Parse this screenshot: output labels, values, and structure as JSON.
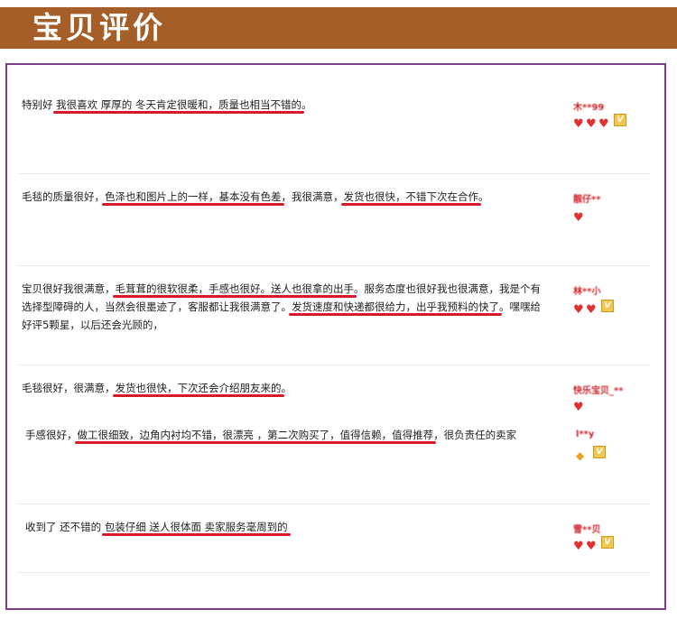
{
  "header": {
    "title": "宝贝评价",
    "bg_color": "#a65e28"
  },
  "panel": {
    "border_color": "#7b3f86"
  },
  "reviews": [
    {
      "segments": [
        {
          "text": "特别好  ",
          "hl": false
        },
        {
          "text": "我很喜欢  厚厚的  冬天肯定很暖和，质量也相当不错的",
          "hl": true
        },
        {
          "text": "。",
          "hl": false
        }
      ],
      "user": "木**99",
      "hearts": 3,
      "diamond": false,
      "vip": true
    },
    {
      "segments": [
        {
          "text": "毛毯的质量很好，",
          "hl": false
        },
        {
          "text": "色泽也和图片上的一样，基本没有色差",
          "hl": true
        },
        {
          "text": "，我很满意，",
          "hl": false
        },
        {
          "text": "发货也很快，不错下次在合作",
          "hl": true
        },
        {
          "text": "。",
          "hl": false
        }
      ],
      "user": "靓仔**",
      "hearts": 1,
      "diamond": false,
      "vip": false
    },
    {
      "segments": [
        {
          "text": "宝贝很好我很满意，",
          "hl": false
        },
        {
          "text": "毛茸茸的很软很柔，手感也很好。送人也很拿的出手",
          "hl": true
        },
        {
          "text": "。服务态度也很好我也很满意，我是个有选择型障碍的人，当然会很墨迹了，客服都让我很满意了。",
          "hl": false
        },
        {
          "text": "发货速度和快递都很给力，出乎我预料的快了",
          "hl": true
        },
        {
          "text": "。嘿嘿给好评5颗星，以后还会光顾的，",
          "hl": false
        }
      ],
      "user": "林**小",
      "hearts": 2,
      "diamond": false,
      "vip": true
    },
    {
      "segments": [
        {
          "text": "毛毯很好，很满意，",
          "hl": false
        },
        {
          "text": "发货也很快，下次还会介绍朋友来的",
          "hl": true
        },
        {
          "text": "。",
          "hl": false
        }
      ],
      "user": "快乐宝贝_**",
      "hearts": 1,
      "diamond": false,
      "vip": false
    },
    {
      "segments": [
        {
          "text": "手感很好，",
          "hl": false
        },
        {
          "text": "做工很细致，边角内衬均不错，很漂亮 ，第二次购买了，值得信赖，值得推荐",
          "hl": true
        },
        {
          "text": "，很负责任的卖家",
          "hl": false
        }
      ],
      "user": "l**y",
      "hearts": 0,
      "diamond": true,
      "vip": true
    },
    {
      "segments": [
        {
          "text": "收到了  还不错的  ",
          "hl": false
        },
        {
          "text": "包装仔细  送人很体面  卖家服务毫周到的",
          "hl": true
        }
      ],
      "user": "雪**贝",
      "hearts": 2,
      "diamond": false,
      "vip": true
    }
  ]
}
